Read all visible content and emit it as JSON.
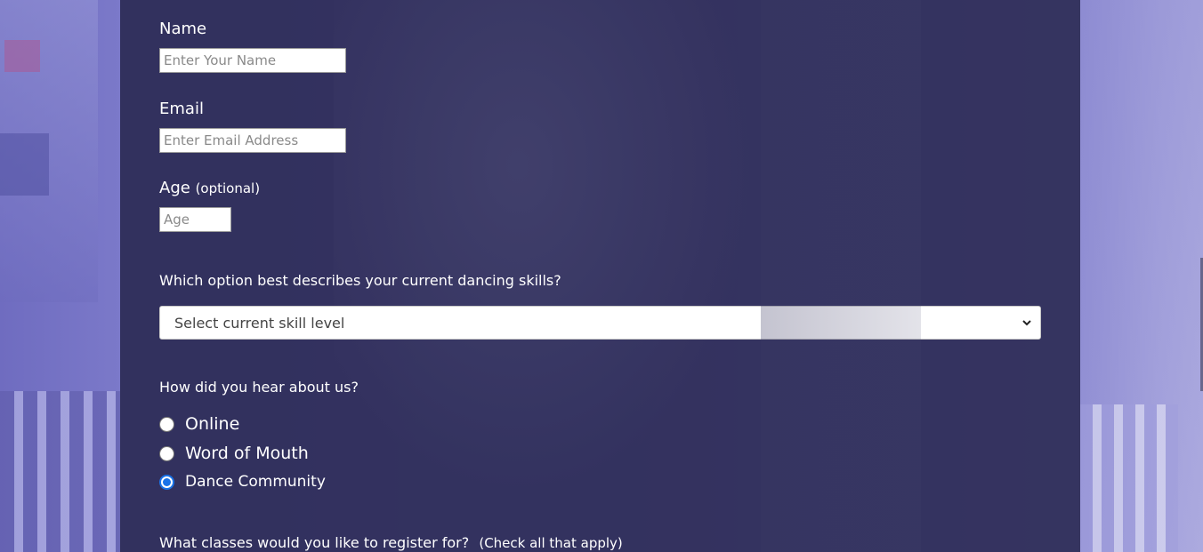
{
  "form": {
    "name": {
      "label": "Name",
      "placeholder": "Enter Your Name"
    },
    "email": {
      "label": "Email",
      "placeholder": "Enter Email Address"
    },
    "age": {
      "label": "Age",
      "optional_note": "(optional)",
      "placeholder": "Age"
    },
    "skill": {
      "question": "Which option best describes your current dancing skills?",
      "selected": "Select current skill level"
    },
    "referral": {
      "question": "How did you hear about us?",
      "options": [
        {
          "label": "Online",
          "checked": false
        },
        {
          "label": "Word of Mouth",
          "checked": false
        },
        {
          "label": "Dance Community",
          "checked": true
        }
      ]
    },
    "classes": {
      "question": "What classes would you like to register for?",
      "note": "(Check all that apply)"
    }
  },
  "colors": {
    "panel": "#2c2b54",
    "accent": "#1a73e8",
    "text": "#ffffff"
  }
}
